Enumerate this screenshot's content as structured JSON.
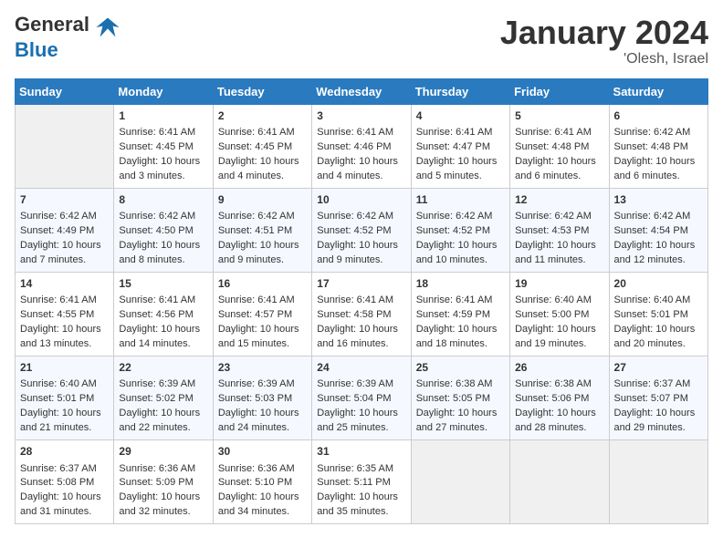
{
  "header": {
    "logo_general": "General",
    "logo_blue": "Blue",
    "title": "January 2024",
    "subtitle": "'Olesh, Israel"
  },
  "columns": [
    "Sunday",
    "Monday",
    "Tuesday",
    "Wednesday",
    "Thursday",
    "Friday",
    "Saturday"
  ],
  "weeks": [
    [
      {
        "empty": true
      },
      {
        "day": "1",
        "sunrise": "6:41 AM",
        "sunset": "4:45 PM",
        "daylight": "10 hours and 3 minutes."
      },
      {
        "day": "2",
        "sunrise": "6:41 AM",
        "sunset": "4:45 PM",
        "daylight": "10 hours and 4 minutes."
      },
      {
        "day": "3",
        "sunrise": "6:41 AM",
        "sunset": "4:46 PM",
        "daylight": "10 hours and 4 minutes."
      },
      {
        "day": "4",
        "sunrise": "6:41 AM",
        "sunset": "4:47 PM",
        "daylight": "10 hours and 5 minutes."
      },
      {
        "day": "5",
        "sunrise": "6:41 AM",
        "sunset": "4:48 PM",
        "daylight": "10 hours and 6 minutes."
      },
      {
        "day": "6",
        "sunrise": "6:42 AM",
        "sunset": "4:48 PM",
        "daylight": "10 hours and 6 minutes."
      }
    ],
    [
      {
        "day": "7",
        "sunrise": "6:42 AM",
        "sunset": "4:49 PM",
        "daylight": "10 hours and 7 minutes."
      },
      {
        "day": "8",
        "sunrise": "6:42 AM",
        "sunset": "4:50 PM",
        "daylight": "10 hours and 8 minutes."
      },
      {
        "day": "9",
        "sunrise": "6:42 AM",
        "sunset": "4:51 PM",
        "daylight": "10 hours and 9 minutes."
      },
      {
        "day": "10",
        "sunrise": "6:42 AM",
        "sunset": "4:52 PM",
        "daylight": "10 hours and 9 minutes."
      },
      {
        "day": "11",
        "sunrise": "6:42 AM",
        "sunset": "4:52 PM",
        "daylight": "10 hours and 10 minutes."
      },
      {
        "day": "12",
        "sunrise": "6:42 AM",
        "sunset": "4:53 PM",
        "daylight": "10 hours and 11 minutes."
      },
      {
        "day": "13",
        "sunrise": "6:42 AM",
        "sunset": "4:54 PM",
        "daylight": "10 hours and 12 minutes."
      }
    ],
    [
      {
        "day": "14",
        "sunrise": "6:41 AM",
        "sunset": "4:55 PM",
        "daylight": "10 hours and 13 minutes."
      },
      {
        "day": "15",
        "sunrise": "6:41 AM",
        "sunset": "4:56 PM",
        "daylight": "10 hours and 14 minutes."
      },
      {
        "day": "16",
        "sunrise": "6:41 AM",
        "sunset": "4:57 PM",
        "daylight": "10 hours and 15 minutes."
      },
      {
        "day": "17",
        "sunrise": "6:41 AM",
        "sunset": "4:58 PM",
        "daylight": "10 hours and 16 minutes."
      },
      {
        "day": "18",
        "sunrise": "6:41 AM",
        "sunset": "4:59 PM",
        "daylight": "10 hours and 18 minutes."
      },
      {
        "day": "19",
        "sunrise": "6:40 AM",
        "sunset": "5:00 PM",
        "daylight": "10 hours and 19 minutes."
      },
      {
        "day": "20",
        "sunrise": "6:40 AM",
        "sunset": "5:01 PM",
        "daylight": "10 hours and 20 minutes."
      }
    ],
    [
      {
        "day": "21",
        "sunrise": "6:40 AM",
        "sunset": "5:01 PM",
        "daylight": "10 hours and 21 minutes."
      },
      {
        "day": "22",
        "sunrise": "6:39 AM",
        "sunset": "5:02 PM",
        "daylight": "10 hours and 22 minutes."
      },
      {
        "day": "23",
        "sunrise": "6:39 AM",
        "sunset": "5:03 PM",
        "daylight": "10 hours and 24 minutes."
      },
      {
        "day": "24",
        "sunrise": "6:39 AM",
        "sunset": "5:04 PM",
        "daylight": "10 hours and 25 minutes."
      },
      {
        "day": "25",
        "sunrise": "6:38 AM",
        "sunset": "5:05 PM",
        "daylight": "10 hours and 27 minutes."
      },
      {
        "day": "26",
        "sunrise": "6:38 AM",
        "sunset": "5:06 PM",
        "daylight": "10 hours and 28 minutes."
      },
      {
        "day": "27",
        "sunrise": "6:37 AM",
        "sunset": "5:07 PM",
        "daylight": "10 hours and 29 minutes."
      }
    ],
    [
      {
        "day": "28",
        "sunrise": "6:37 AM",
        "sunset": "5:08 PM",
        "daylight": "10 hours and 31 minutes."
      },
      {
        "day": "29",
        "sunrise": "6:36 AM",
        "sunset": "5:09 PM",
        "daylight": "10 hours and 32 minutes."
      },
      {
        "day": "30",
        "sunrise": "6:36 AM",
        "sunset": "5:10 PM",
        "daylight": "10 hours and 34 minutes."
      },
      {
        "day": "31",
        "sunrise": "6:35 AM",
        "sunset": "5:11 PM",
        "daylight": "10 hours and 35 minutes."
      },
      {
        "empty": true
      },
      {
        "empty": true
      },
      {
        "empty": true
      }
    ]
  ],
  "labels": {
    "sunrise": "Sunrise:",
    "sunset": "Sunset:",
    "daylight": "Daylight:"
  }
}
